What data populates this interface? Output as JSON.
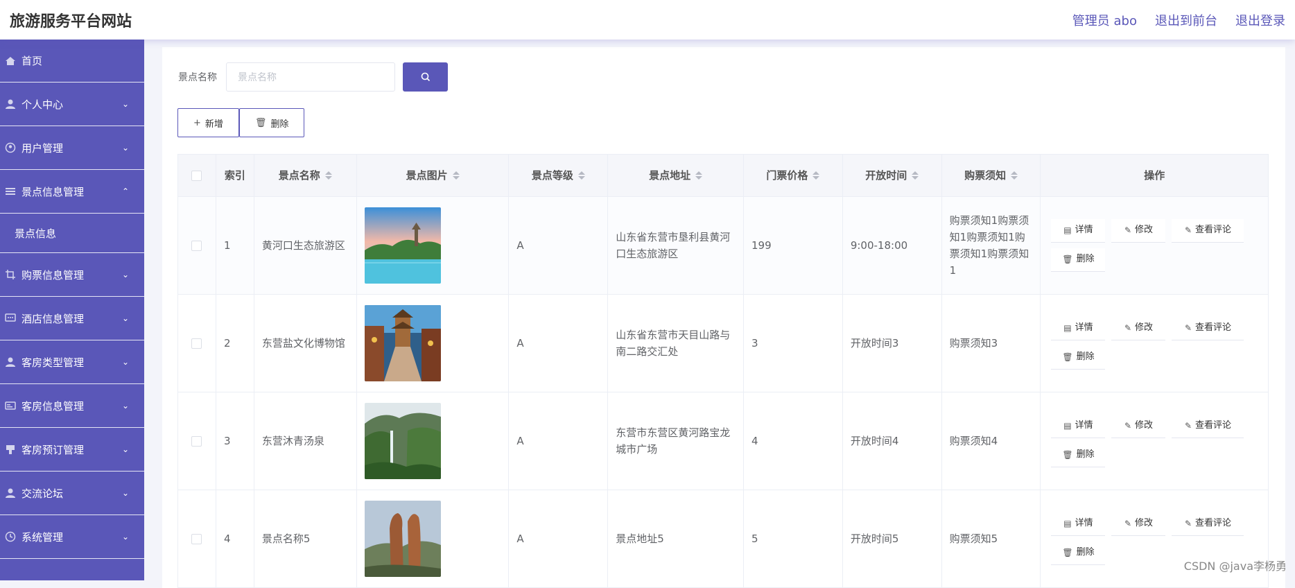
{
  "header": {
    "title": "旅游服务平台网站",
    "links": [
      "管理员 abo",
      "退出到前台",
      "退出登录"
    ]
  },
  "sidebar": {
    "items": [
      {
        "label": "首页",
        "icon": "home-icon"
      },
      {
        "label": "个人中心",
        "icon": "user-icon"
      },
      {
        "label": "用户管理",
        "icon": "users-icon"
      },
      {
        "label": "景点信息管理",
        "icon": "list-icon",
        "expanded": true,
        "sub": [
          "景点信息"
        ]
      },
      {
        "label": "购票信息管理",
        "icon": "crop-icon"
      },
      {
        "label": "酒店信息管理",
        "icon": "chat-icon"
      },
      {
        "label": "客房类型管理",
        "icon": "person-icon"
      },
      {
        "label": "客房信息管理",
        "icon": "card-icon"
      },
      {
        "label": "客房预订管理",
        "icon": "stamp-icon"
      },
      {
        "label": "交流论坛",
        "icon": "person2-icon"
      },
      {
        "label": "系统管理",
        "icon": "clock-icon"
      }
    ]
  },
  "search": {
    "label": "景点名称",
    "placeholder": "景点名称",
    "value": ""
  },
  "toolbar": {
    "add_label": "新增",
    "delete_label": "删除"
  },
  "table": {
    "columns": [
      "索引",
      "景点名称",
      "景点图片",
      "景点等级",
      "景点地址",
      "门票价格",
      "开放时间",
      "购票须知",
      "操作"
    ],
    "rows": [
      {
        "index": "1",
        "name": "黄河口生态旅游区",
        "level": "A",
        "address": "山东省东营市垦利县黄河口生态旅游区",
        "price": "199",
        "hours": "9:00-18:00",
        "notice": "购票须知1购票须知1购票须知1购票须知1购票须知1"
      },
      {
        "index": "2",
        "name": "东营盐文化博物馆",
        "level": "A",
        "address": "山东省东营市天目山路与南二路交汇处",
        "price": "3",
        "hours": "开放时间3",
        "notice": "购票须知3"
      },
      {
        "index": "3",
        "name": "东营沐青汤泉",
        "level": "A",
        "address": "东营市东营区黄河路宝龙城市广场",
        "price": "4",
        "hours": "开放时间4",
        "notice": "购票须知4"
      },
      {
        "index": "4",
        "name": "景点名称5",
        "level": "A",
        "address": "景点地址5",
        "price": "5",
        "hours": "开放时间5",
        "notice": "购票须知5"
      }
    ],
    "actions": {
      "detail": "详情",
      "edit": "修改",
      "comments": "查看评论",
      "delete": "删除"
    }
  },
  "watermark": "CSDN @java李杨勇",
  "colors": {
    "accent": "#5a57b8",
    "background": "#f3f4fa"
  }
}
